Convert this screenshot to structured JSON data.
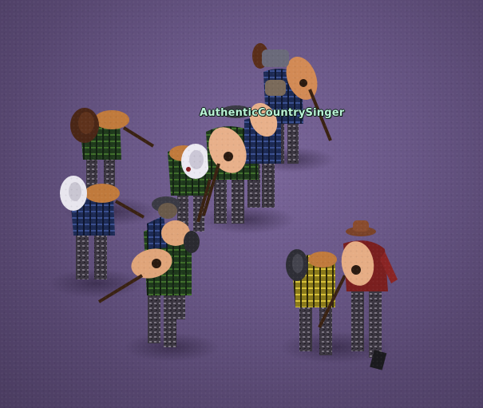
{
  "player": {
    "name_tag": "AuthenticCountrySinger"
  },
  "scene": {
    "floor_color": "#6a5888",
    "characters": [
      {
        "id": "zombie-1",
        "hat": "brown-cowboy-hat",
        "shirt": "green-plaid",
        "carrying": "guitar"
      },
      {
        "id": "zombie-2",
        "hat": "brown-cowboy-hat",
        "shirt": "blue-plaid",
        "carrying": "guitar"
      },
      {
        "id": "zombie-3",
        "hat": "white-cowboy-hat",
        "shirt": "blue-plaid",
        "carrying": "guitar"
      },
      {
        "id": "zombie-4",
        "hat": "white-cowboy-hat",
        "shirt": "green-plaid",
        "carrying": "guitar"
      },
      {
        "id": "player-character",
        "hat": "dark-cowboy-hat",
        "shirt": "green-plaid",
        "carrying": "guitar"
      },
      {
        "id": "zombie-5",
        "hat": "dark-cowboy-hat",
        "shirt": "blue-plaid",
        "carrying": "guitar"
      },
      {
        "id": "zombie-6",
        "hat": "dark-cowboy-hat",
        "shirt": "green-plaid",
        "carrying": "guitar"
      },
      {
        "id": "zombie-7",
        "hat": "dark-cowboy-hat",
        "shirt": "yellow-plaid",
        "carrying": "guitar"
      },
      {
        "id": "zombie-8",
        "hat": "brown-cowboy-hat",
        "shirt": "red-flannel",
        "carrying": "guitar"
      }
    ]
  }
}
